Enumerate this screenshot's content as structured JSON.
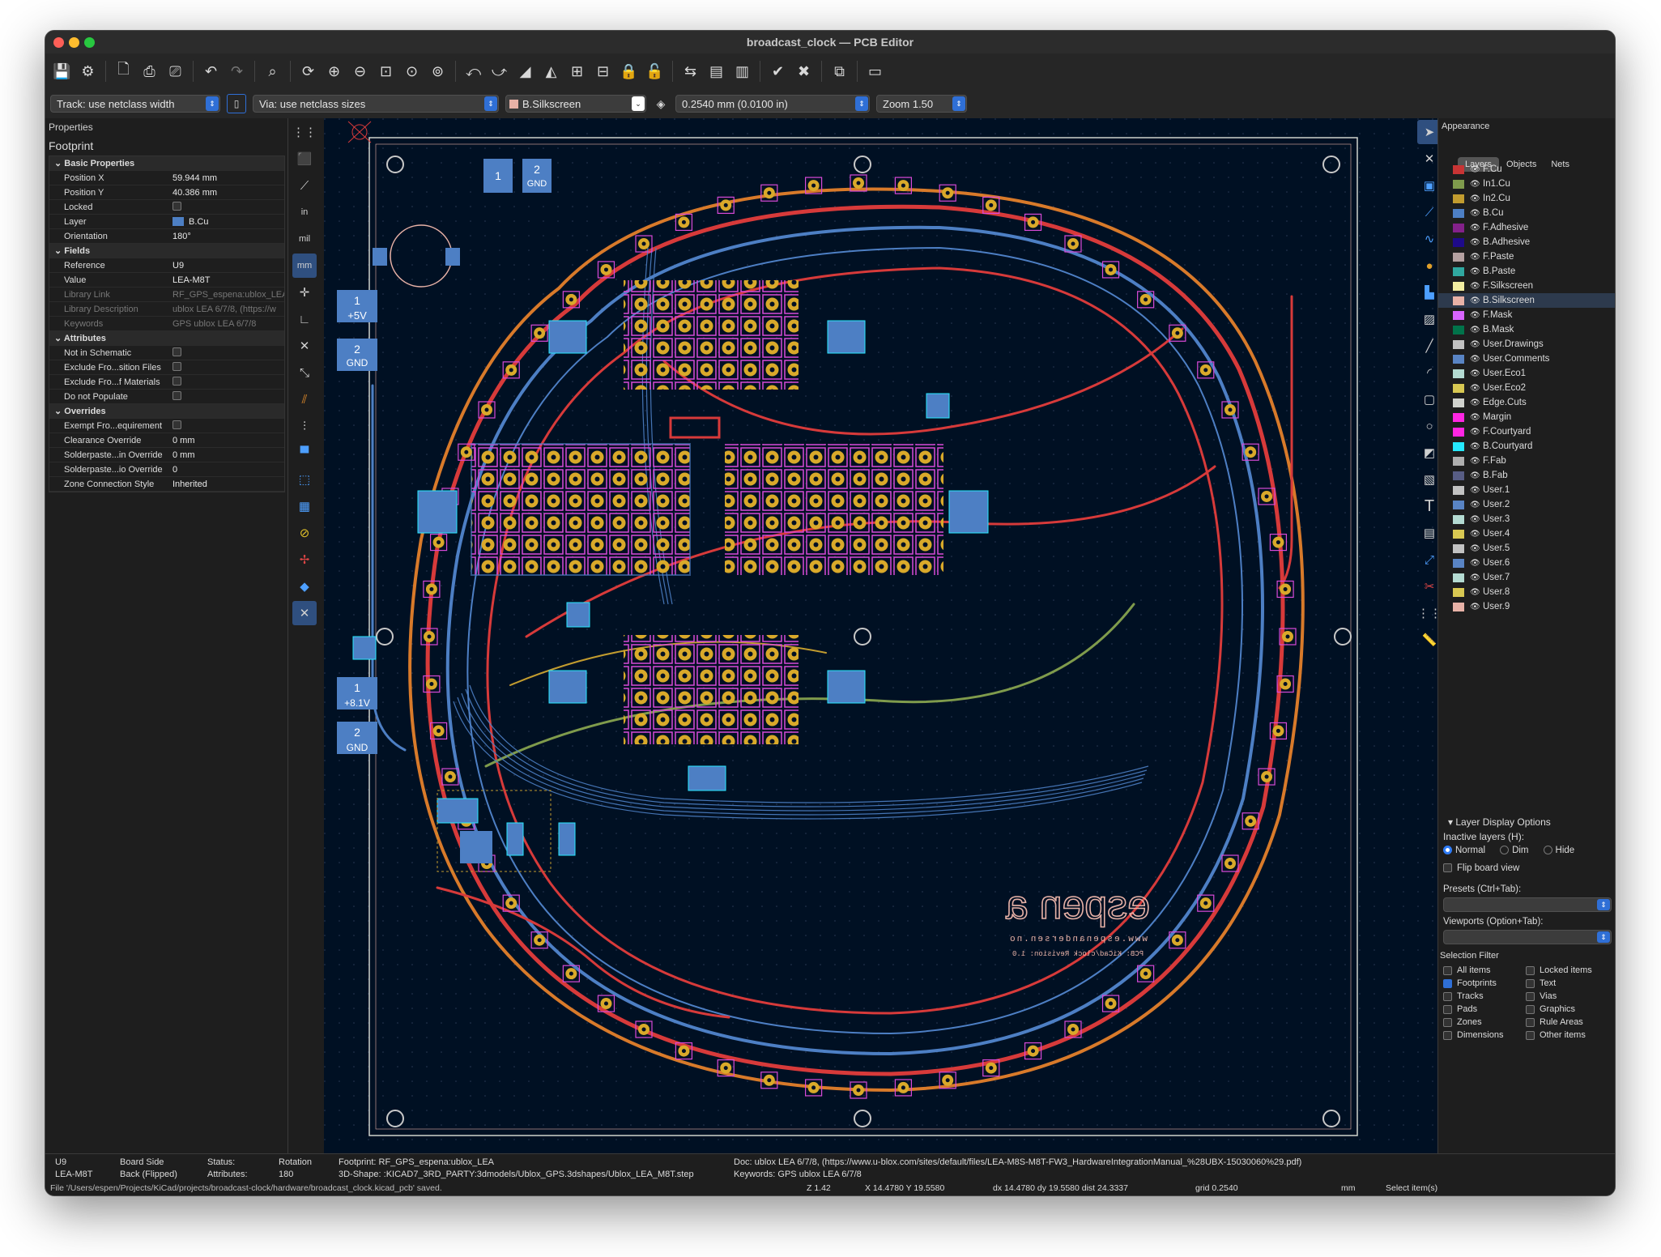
{
  "window": {
    "title": "broadcast_clock — PCB Editor"
  },
  "toolbar2": {
    "track": "Track: use netclass width",
    "via": "Via: use netclass sizes",
    "layer": "B.Silkscreen",
    "grid": "0.2540 mm (0.0100 in)",
    "zoom": "Zoom 1.50"
  },
  "properties": {
    "title": "Properties",
    "subtitle": "Footprint",
    "rows": [
      {
        "k": "Basic Properties",
        "section": true
      },
      {
        "k": "Position X",
        "v": "59.944 mm"
      },
      {
        "k": "Position Y",
        "v": "40.386 mm"
      },
      {
        "k": "Locked",
        "v": ""
      },
      {
        "k": "Layer",
        "v": "B.Cu"
      },
      {
        "k": "Orientation",
        "v": "180°"
      },
      {
        "k": "Fields",
        "section": true
      },
      {
        "k": "Reference",
        "v": "U9"
      },
      {
        "k": "Value",
        "v": "LEA-M8T"
      },
      {
        "k": "Library Link",
        "v": "RF_GPS_espena:ublox_LEA",
        "dim": true
      },
      {
        "k": "Library Description",
        "v": "ublox LEA 6/7/8, (https://w",
        "dim": true
      },
      {
        "k": "Keywords",
        "v": "GPS ublox LEA 6/7/8",
        "dim": true
      },
      {
        "k": "Attributes",
        "section": true
      },
      {
        "k": "Not in Schematic",
        "v": ""
      },
      {
        "k": "Exclude Fro...sition Files",
        "v": ""
      },
      {
        "k": "Exclude Fro...f Materials",
        "v": ""
      },
      {
        "k": "Do not Populate",
        "v": ""
      },
      {
        "k": "Overrides",
        "section": true
      },
      {
        "k": "Exempt Fro...equirement",
        "v": ""
      },
      {
        "k": "Clearance Override",
        "v": "0 mm"
      },
      {
        "k": "Solderpaste...in Override",
        "v": "0 mm"
      },
      {
        "k": "Solderpaste...io Override",
        "v": "0"
      },
      {
        "k": "Zone Connection Style",
        "v": "Inherited"
      }
    ]
  },
  "appearance": {
    "title": "Appearance",
    "tabs": [
      "Layers",
      "Objects",
      "Nets"
    ],
    "layers": [
      {
        "name": "F.Cu",
        "color": "#c83434"
      },
      {
        "name": "In1.Cu",
        "color": "#7f9b4c"
      },
      {
        "name": "In2.Cu",
        "color": "#c29c2f"
      },
      {
        "name": "B.Cu",
        "color": "#4d7fc4"
      },
      {
        "name": "F.Adhesive",
        "color": "#84218a"
      },
      {
        "name": "B.Adhesive",
        "color": "#1e0a8a"
      },
      {
        "name": "F.Paste",
        "color": "#b4a0a0"
      },
      {
        "name": "B.Paste",
        "color": "#30a8a0"
      },
      {
        "name": "F.Silkscreen",
        "color": "#f2eda1"
      },
      {
        "name": "B.Silkscreen",
        "color": "#e8b2a7"
      },
      {
        "name": "F.Mask",
        "color": "#d864ff"
      },
      {
        "name": "B.Mask",
        "color": "#01734a"
      },
      {
        "name": "User.Drawings",
        "color": "#c2c2c2"
      },
      {
        "name": "User.Comments",
        "color": "#5984c4"
      },
      {
        "name": "User.Eco1",
        "color": "#b4dbd2"
      },
      {
        "name": "User.Eco2",
        "color": "#d8c852"
      },
      {
        "name": "Edge.Cuts",
        "color": "#d0d2cd"
      },
      {
        "name": "Margin",
        "color": "#ff26e2"
      },
      {
        "name": "F.Courtyard",
        "color": "#ff26e2"
      },
      {
        "name": "B.Courtyard",
        "color": "#26e9ff"
      },
      {
        "name": "F.Fab",
        "color": "#afafaf"
      },
      {
        "name": "B.Fab",
        "color": "#585d84"
      },
      {
        "name": "User.1",
        "color": "#c2c2c2"
      },
      {
        "name": "User.2",
        "color": "#5984c4"
      },
      {
        "name": "User.3",
        "color": "#b4dbd2"
      },
      {
        "name": "User.4",
        "color": "#d8c852"
      },
      {
        "name": "User.5",
        "color": "#c2c2c2"
      },
      {
        "name": "User.6",
        "color": "#5984c4"
      },
      {
        "name": "User.7",
        "color": "#b4dbd2"
      },
      {
        "name": "User.8",
        "color": "#d8c852"
      },
      {
        "name": "User.9",
        "color": "#e8b2a7"
      }
    ],
    "display_options": "Layer Display Options",
    "inactive_label": "Inactive layers (H):",
    "inactive_options": [
      "Normal",
      "Dim",
      "Hide"
    ],
    "flip_board": "Flip board view",
    "presets": "Presets (Ctrl+Tab):",
    "viewports": "Viewports (Option+Tab):",
    "selection_filter": "Selection Filter",
    "filters_left": [
      "All items",
      "Footprints",
      "Tracks",
      "Pads",
      "Zones",
      "Dimensions"
    ],
    "filters_right": [
      "Locked items",
      "Text",
      "Vias",
      "Graphics",
      "Rule Areas",
      "Other items"
    ]
  },
  "board": {
    "logo": "espen a",
    "url": "www.espenandersen.no",
    "pcb": "PCB: KiCad/clock Revision: 1.0",
    "labels": {
      "p5v_num": "1",
      "p5v": "+5V",
      "gnd1_num": "2",
      "gnd1": "GND",
      "p81_num": "1",
      "p81": "+8.1V",
      "gnd2_num": "2",
      "gnd2": "GND",
      "top1": "1",
      "top2": "2",
      "top2b": "GND"
    }
  },
  "status": {
    "ref": "U9",
    "val": "LEA-M8T",
    "board_side_label": "Board Side",
    "board_side": "Back (Flipped)",
    "status_label": "Status:",
    "attrs_label": "Attributes:",
    "rotation_label": "Rotation",
    "rotation": "180",
    "footprint": "Footprint: RF_GPS_espena:ublox_LEA",
    "shape": "3D-Shape: :KICAD7_3RD_PARTY:3dmodels/Ublox_GPS.3dshapes/Ublox_LEA_M8T.step",
    "doc": "Doc: ublox LEA 6/7/8, (https://www.u-blox.com/sites/default/files/LEA-M8S-M8T-FW3_HardwareIntegrationManual_%28UBX-15030060%29.pdf)",
    "keywords": "Keywords: GPS ublox LEA 6/7/8",
    "file": "File '/Users/espen/Projects/KiCad/projects/broadcast-clock/hardware/broadcast_clock.kicad_pcb' saved.",
    "z": "Z 1.42",
    "xy": "X 14.4780  Y 19.5580",
    "dxy": "dx 14.4780  dy 19.5580  dist 24.3337",
    "grid": "grid 0.2540",
    "unit": "mm",
    "mode": "Select item(s)"
  },
  "colors": {
    "fcu": "#d73a3a",
    "bcu": "#4d7fc4",
    "pad": "#d9a92a",
    "bg": "#001023"
  }
}
